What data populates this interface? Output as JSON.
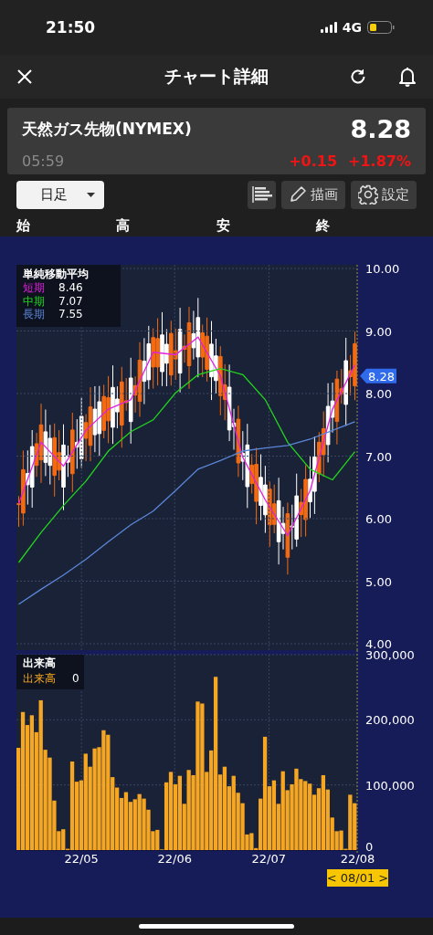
{
  "status_bar": {
    "time": "21:50",
    "network": "4G"
  },
  "header": {
    "title": "チャート詳細"
  },
  "quote": {
    "name": "天然ガス先物(NYMEX)",
    "price": "8.28",
    "time": "05:59",
    "change": "+0.15",
    "change_percent": "+1.87%"
  },
  "toolbar": {
    "period": "日足",
    "draw_label": "描画",
    "settings_label": "設定"
  },
  "ohlc_labels": [
    "始",
    "高",
    "安",
    "終"
  ],
  "price_chart": {
    "legend_title": "単純移動平均",
    "legend_values": [
      "8.46",
      "7.07",
      "7.55"
    ],
    "current_price": "8.28",
    "chart_data": {
      "type": "line",
      "grid": true,
      "ylim": [
        4,
        10
      ],
      "yticks": [
        {
          "value": 4,
          "label": "4.00"
        },
        {
          "value": 5,
          "label": "5.00"
        },
        {
          "value": 6,
          "label": "6.00"
        },
        {
          "value": 7,
          "label": "7.00"
        },
        {
          "value": 8,
          "label": "8.00"
        },
        {
          "value": 9,
          "label": "9.00"
        },
        {
          "value": 10,
          "label": "10.00"
        }
      ],
      "series": [
        {
          "name": "短期",
          "color": "#e21ee0",
          "values": [
            6.24,
            7.22,
            6.84,
            7.41,
            7.75,
            7.9,
            8.66,
            8.62,
            8.9,
            8.28,
            6.98,
            6.3,
            5.73,
            6.45,
            7.75,
            8.46
          ]
        },
        {
          "name": "中期",
          "color": "#22d61e",
          "values": [
            5.3,
            5.78,
            6.21,
            6.6,
            7.08,
            7.39,
            7.58,
            8.01,
            8.3,
            8.4,
            8.3,
            7.9,
            7.22,
            6.79,
            6.62,
            7.07
          ]
        },
        {
          "name": "長期",
          "color": "#5b86d8",
          "values": [
            4.63,
            4.87,
            5.1,
            5.35,
            5.63,
            5.9,
            6.12,
            6.45,
            6.79,
            6.93,
            7.08,
            7.13,
            7.17,
            7.27,
            7.41,
            7.55
          ]
        }
      ]
    }
  },
  "volume_chart": {
    "legend_title": "出来高",
    "legend_values": [
      "0"
    ],
    "date_labels": [
      "22/05",
      "22/06",
      "22/07",
      "22/08"
    ],
    "cursor_label": "< 08/01 >",
    "chart_data": {
      "type": "bar",
      "grid": true,
      "ylim": [
        0,
        300000
      ],
      "yticks": [
        {
          "value": 0,
          "label": "0"
        },
        {
          "value": 100000,
          "label": "100,000"
        },
        {
          "value": 200000,
          "label": "200,000"
        },
        {
          "value": 300000,
          "label": "300,000"
        }
      ],
      "series": [
        {
          "name": "出来高",
          "color": "#f5a623",
          "values": [
            157000,
            212000,
            192000,
            207000,
            181000,
            230000,
            154000,
            142000,
            76000,
            29000,
            32000,
            2000,
            136000,
            105000,
            107000,
            148000,
            128000,
            156000,
            158000,
            184000,
            177000,
            112000,
            96000,
            80000,
            89000,
            74000,
            78000,
            86000,
            79000,
            62000,
            29000,
            31000,
            1000,
            104000,
            120000,
            101000,
            114000,
            71000,
            123000,
            115000,
            228000,
            225000,
            120000,
            153000,
            266000,
            116000,
            128000,
            98000,
            114000,
            88000,
            72000,
            24000,
            26000,
            3000,
            79000,
            174000,
            98000,
            107000,
            71000,
            121000,
            92000,
            101000,
            125000,
            109000,
            106000,
            102000,
            85000,
            95000,
            115000,
            93000,
            50000,
            29000,
            30000,
            2000,
            85000,
            72000
          ]
        }
      ]
    }
  }
}
